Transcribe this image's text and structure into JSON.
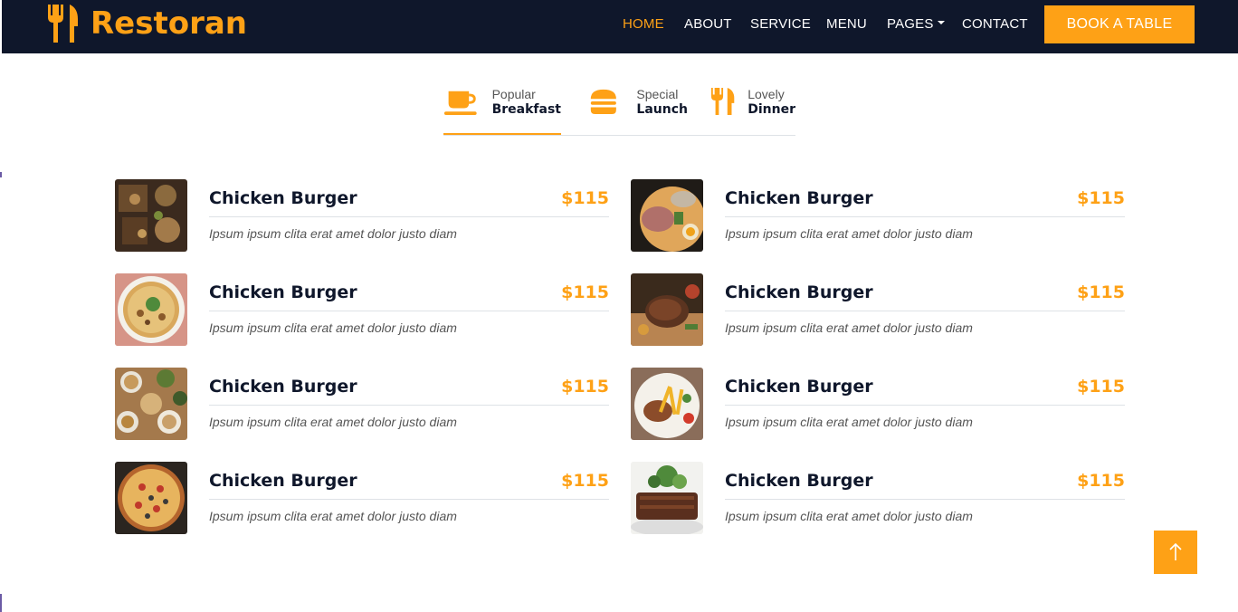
{
  "brand": {
    "name": "Restoran",
    "icon": "utensils-icon",
    "color": "#fea116"
  },
  "nav": {
    "links": [
      "HOME",
      "ABOUT",
      "SERVICE",
      "MENU",
      "PAGES",
      "CONTACT"
    ],
    "active": "HOME",
    "cta": "BOOK A TABLE"
  },
  "tabs": [
    {
      "small": "Popular",
      "big": "Breakfast",
      "icon": "coffee-icon",
      "active": true
    },
    {
      "small": "Special",
      "big": "Launch",
      "icon": "hamburger-icon",
      "active": false
    },
    {
      "small": "Lovely",
      "big": "Dinner",
      "icon": "utensils-icon",
      "active": false
    }
  ],
  "menu_items": [
    {
      "name": "Chicken Burger",
      "price": "$115",
      "desc": "Ipsum ipsum clita erat amet dolor justo diam"
    },
    {
      "name": "Chicken Burger",
      "price": "$115",
      "desc": "Ipsum ipsum clita erat amet dolor justo diam"
    },
    {
      "name": "Chicken Burger",
      "price": "$115",
      "desc": "Ipsum ipsum clita erat amet dolor justo diam"
    },
    {
      "name": "Chicken Burger",
      "price": "$115",
      "desc": "Ipsum ipsum clita erat amet dolor justo diam"
    },
    {
      "name": "Chicken Burger",
      "price": "$115",
      "desc": "Ipsum ipsum clita erat amet dolor justo diam"
    },
    {
      "name": "Chicken Burger",
      "price": "$115",
      "desc": "Ipsum ipsum clita erat amet dolor justo diam"
    },
    {
      "name": "Chicken Burger",
      "price": "$115",
      "desc": "Ipsum ipsum clita erat amet dolor justo diam"
    },
    {
      "name": "Chicken Burger",
      "price": "$115",
      "desc": "Ipsum ipsum clita erat amet dolor justo diam"
    }
  ],
  "back_to_top": {
    "icon": "arrow-up-icon"
  },
  "colors": {
    "primary": "#fea116",
    "dark": "#0f172b",
    "text_muted": "#555555",
    "border": "#dee2e6"
  }
}
